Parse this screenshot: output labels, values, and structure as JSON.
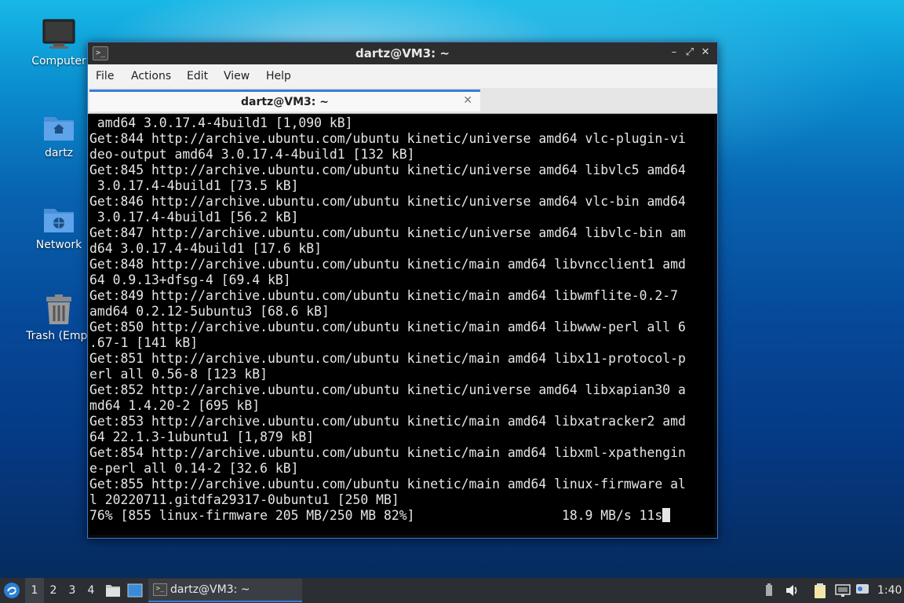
{
  "desktop": {
    "icons": [
      {
        "label": "Computer"
      },
      {
        "label": "dartz"
      },
      {
        "label": "Network"
      },
      {
        "label": "Trash (Empt"
      }
    ]
  },
  "window": {
    "title": "dartz@VM3: ~",
    "menu": [
      "File",
      "Actions",
      "Edit",
      "View",
      "Help"
    ],
    "tab": {
      "title": "dartz@VM3: ~"
    },
    "terminal_lines": [
      " amd64 3.0.17.4-4build1 [1,090 kB]",
      "Get:844 http://archive.ubuntu.com/ubuntu kinetic/universe amd64 vlc-plugin-vi",
      "deo-output amd64 3.0.17.4-4build1 [132 kB]",
      "Get:845 http://archive.ubuntu.com/ubuntu kinetic/universe amd64 libvlc5 amd64",
      " 3.0.17.4-4build1 [73.5 kB]",
      "Get:846 http://archive.ubuntu.com/ubuntu kinetic/universe amd64 vlc-bin amd64",
      " 3.0.17.4-4build1 [56.2 kB]",
      "Get:847 http://archive.ubuntu.com/ubuntu kinetic/universe amd64 libvlc-bin am",
      "d64 3.0.17.4-4build1 [17.6 kB]",
      "Get:848 http://archive.ubuntu.com/ubuntu kinetic/main amd64 libvncclient1 amd",
      "64 0.9.13+dfsg-4 [69.4 kB]",
      "Get:849 http://archive.ubuntu.com/ubuntu kinetic/main amd64 libwmflite-0.2-7",
      "amd64 0.2.12-5ubuntu3 [68.6 kB]",
      "Get:850 http://archive.ubuntu.com/ubuntu kinetic/main amd64 libwww-perl all 6",
      ".67-1 [141 kB]",
      "Get:851 http://archive.ubuntu.com/ubuntu kinetic/main amd64 libx11-protocol-p",
      "erl all 0.56-8 [123 kB]",
      "Get:852 http://archive.ubuntu.com/ubuntu kinetic/universe amd64 libxapian30 a",
      "md64 1.4.20-2 [695 kB]",
      "Get:853 http://archive.ubuntu.com/ubuntu kinetic/main amd64 libxatracker2 amd",
      "64 22.1.3-1ubuntu1 [1,879 kB]",
      "Get:854 http://archive.ubuntu.com/ubuntu kinetic/main amd64 libxml-xpathengin",
      "e-perl all 0.14-2 [32.6 kB]",
      "Get:855 http://archive.ubuntu.com/ubuntu kinetic/main amd64 linux-firmware al",
      "l 20220711.gitdfa29317-0ubuntu1 [250 MB]"
    ],
    "progress_line": "76% [855 linux-firmware 205 MB/250 MB 82%]                   18.9 MB/s 11s"
  },
  "taskbar": {
    "workspaces": [
      "1",
      "2",
      "3",
      "4"
    ],
    "active_workspace": "1",
    "task_title": "dartz@VM3: ~",
    "clock": "1:40",
    "icons": [
      "start-menu-icon",
      "file-manager-icon",
      "show-desktop-icon",
      "terminal-icon",
      "volume-icon",
      "clipboard-icon",
      "network-icon",
      "notification-icon"
    ]
  },
  "colors": {
    "accent": "#3a7bd5",
    "terminal_bg": "#000000",
    "terminal_fg": "#e6e6e6"
  }
}
